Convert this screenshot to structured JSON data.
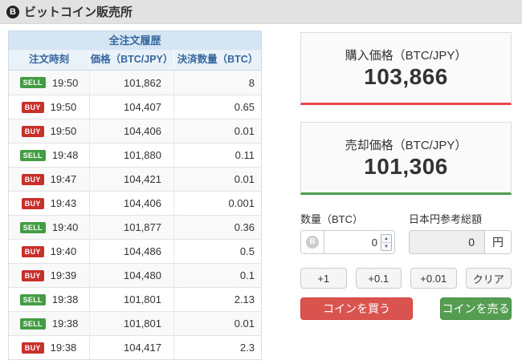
{
  "header": {
    "icon": "B",
    "title": "ビットコイン販売所"
  },
  "order_table": {
    "title": "全注文履歴",
    "columns": [
      "注文時刻",
      "価格（BTC/JPY）",
      "決済数量（BTC）"
    ],
    "rows": [
      {
        "side": "SELL",
        "time": "19:50",
        "price": "101,862",
        "amount": "8"
      },
      {
        "side": "BUY",
        "time": "19:50",
        "price": "104,407",
        "amount": "0.65"
      },
      {
        "side": "BUY",
        "time": "19:50",
        "price": "104,406",
        "amount": "0.01"
      },
      {
        "side": "SELL",
        "time": "19:48",
        "price": "101,880",
        "amount": "0.11"
      },
      {
        "side": "BUY",
        "time": "19:47",
        "price": "104,421",
        "amount": "0.01"
      },
      {
        "side": "BUY",
        "time": "19:43",
        "price": "104,406",
        "amount": "0.001"
      },
      {
        "side": "SELL",
        "time": "19:40",
        "price": "101,877",
        "amount": "0.36"
      },
      {
        "side": "BUY",
        "time": "19:40",
        "price": "104,486",
        "amount": "0.5"
      },
      {
        "side": "BUY",
        "time": "19:39",
        "price": "104,480",
        "amount": "0.1"
      },
      {
        "side": "SELL",
        "time": "19:38",
        "price": "101,801",
        "amount": "2.13"
      },
      {
        "side": "SELL",
        "time": "19:38",
        "price": "101,801",
        "amount": "0.01"
      },
      {
        "side": "BUY",
        "time": "19:38",
        "price": "104,417",
        "amount": "2.3"
      }
    ]
  },
  "buy_price_card": {
    "label": "購入価格（BTC/JPY）",
    "value": "103,866"
  },
  "sell_price_card": {
    "label": "売却価格（BTC/JPY）",
    "value": "101,306"
  },
  "order_form": {
    "amount_label": "数量（BTC）",
    "amount_value": "0",
    "btc_icon": "B",
    "total_label": "日本円参考総額",
    "total_value": "0",
    "total_unit": "円",
    "increment_buttons": [
      "+1",
      "+0.1",
      "+0.01",
      "クリア"
    ],
    "buy_button": "コインを買う",
    "sell_button": "コインを売る"
  },
  "colors": {
    "buy_accent": "#d9534f",
    "sell_accent": "#559e51",
    "buy_underline": "#e8474f",
    "sell_underline": "#4c9c4f",
    "sell_badge": "#449d44",
    "buy_badge": "#c9302c",
    "table_header_bg": "#d5e5f3",
    "table_header_text": "#36679e"
  }
}
